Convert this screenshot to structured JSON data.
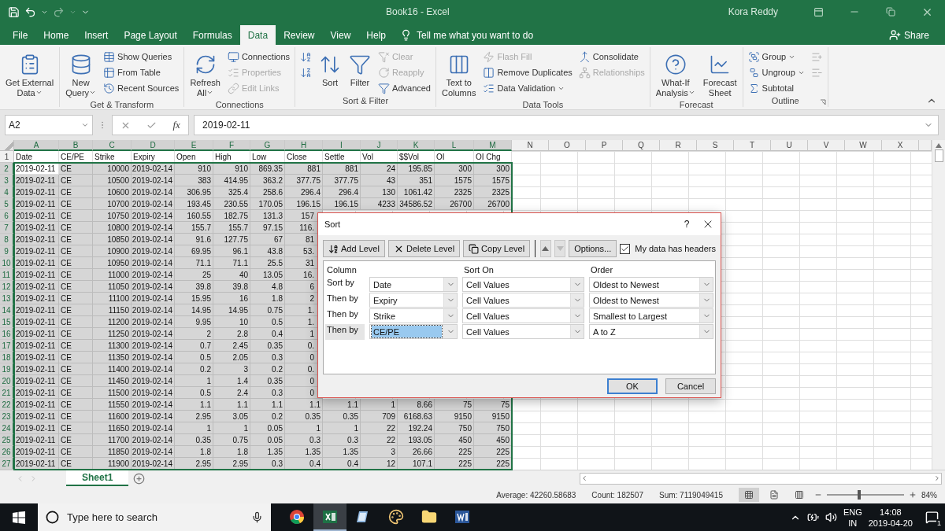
{
  "title_bar": {
    "title": "Book16 - Excel",
    "user": "Kora Reddy"
  },
  "menu_tabs": [
    {
      "label": "File",
      "selected": false
    },
    {
      "label": "Home",
      "selected": false
    },
    {
      "label": "Insert",
      "selected": false
    },
    {
      "label": "Page Layout",
      "selected": false
    },
    {
      "label": "Formulas",
      "selected": false
    },
    {
      "label": "Data",
      "selected": true
    },
    {
      "label": "Review",
      "selected": false
    },
    {
      "label": "View",
      "selected": false
    },
    {
      "label": "Help",
      "selected": false
    }
  ],
  "tell_me": "Tell me what you want to do",
  "share": "Share",
  "ribbon": {
    "groups": [
      {
        "items": [
          {
            "kind": "large",
            "lines": [
              "Get External",
              "Data"
            ],
            "dropdown": true,
            "disabled": false
          }
        ]
      },
      {
        "label": "Get & Transform",
        "items": [
          {
            "kind": "large",
            "lines": [
              "New",
              "Query"
            ],
            "dropdown": true,
            "disabled": false
          },
          {
            "kind": "stack",
            "items": [
              {
                "label": "Show Queries",
                "dropdown": false,
                "disabled": false
              },
              {
                "label": "From Table",
                "dropdown": false,
                "disabled": false
              },
              {
                "label": "Recent Sources",
                "dropdown": false,
                "disabled": false
              }
            ]
          }
        ]
      },
      {
        "label": "Connections",
        "items": [
          {
            "kind": "large",
            "lines": [
              "Refresh",
              "All"
            ],
            "dropdown": true,
            "disabled": false
          },
          {
            "kind": "stack",
            "items": [
              {
                "label": "Connections",
                "dropdown": false,
                "disabled": false
              },
              {
                "label": "Properties",
                "dropdown": false,
                "disabled": true
              },
              {
                "label": "Edit Links",
                "dropdown": false,
                "disabled": true
              }
            ]
          }
        ]
      },
      {
        "label": "Sort & Filter",
        "items": [
          {
            "kind": "stack",
            "items": [
              {
                "dropdown": false,
                "disabled": false
              },
              {
                "dropdown": false,
                "disabled": false
              }
            ]
          },
          {
            "kind": "large",
            "lines": [
              "Sort"
            ],
            "dropdown": false,
            "disabled": false
          },
          {
            "kind": "large",
            "lines": [
              "Filter"
            ],
            "dropdown": false,
            "disabled": false
          },
          {
            "kind": "stack",
            "items": [
              {
                "label": "Clear",
                "dropdown": false,
                "disabled": true
              },
              {
                "label": "Reapply",
                "dropdown": false,
                "disabled": true
              },
              {
                "label": "Advanced",
                "dropdown": false,
                "disabled": false
              }
            ]
          }
        ]
      },
      {
        "label": "Data Tools",
        "items": [
          {
            "kind": "large",
            "lines": [
              "Text to",
              "Columns"
            ],
            "dropdown": false,
            "disabled": false
          },
          {
            "kind": "stack",
            "items": [
              {
                "label": "Flash Fill",
                "dropdown": false,
                "disabled": true
              },
              {
                "label": "Remove Duplicates",
                "dropdown": false,
                "disabled": false
              },
              {
                "label": "Data Validation",
                "dropdown": true,
                "disabled": false
              }
            ]
          },
          {
            "kind": "stack",
            "items": [
              {
                "label": "Consolidate",
                "dropdown": false,
                "disabled": false
              },
              {
                "label": "Relationships",
                "dropdown": false,
                "disabled": true
              }
            ]
          }
        ]
      },
      {
        "label": "Forecast",
        "items": [
          {
            "kind": "large",
            "lines": [
              "What-If",
              "Analysis"
            ],
            "dropdown": true,
            "disabled": false
          },
          {
            "kind": "large",
            "lines": [
              "Forecast",
              "Sheet"
            ],
            "dropdown": false,
            "disabled": false
          }
        ]
      },
      {
        "label": "Outline",
        "launcher": true,
        "items": [
          {
            "kind": "stack",
            "items": [
              {
                "label": "Group",
                "dropdown": true,
                "disabled": false
              },
              {
                "label": "Ungroup",
                "dropdown": true,
                "disabled": false
              },
              {
                "label": "Subtotal",
                "dropdown": false,
                "disabled": false
              }
            ]
          },
          {
            "kind": "stack",
            "items": [
              {
                "dropdown": false,
                "disabled": true
              },
              {
                "dropdown": false,
                "disabled": true
              }
            ]
          }
        ]
      }
    ]
  },
  "formula_bar": {
    "name_box": "A2",
    "fx": "fx",
    "value": "2019-02-11"
  },
  "columns": [
    {
      "letter": "A",
      "selected": true
    },
    {
      "letter": "B",
      "selected": true
    },
    {
      "letter": "C",
      "selected": true
    },
    {
      "letter": "D",
      "selected": true
    },
    {
      "letter": "E",
      "selected": true
    },
    {
      "letter": "F",
      "selected": true
    },
    {
      "letter": "G",
      "selected": true
    },
    {
      "letter": "H",
      "selected": true
    },
    {
      "letter": "I",
      "selected": true
    },
    {
      "letter": "J",
      "selected": true
    },
    {
      "letter": "K",
      "selected": true
    },
    {
      "letter": "L",
      "selected": true
    },
    {
      "letter": "M",
      "selected": true
    },
    {
      "letter": "N",
      "selected": false
    },
    {
      "letter": "O",
      "selected": false
    },
    {
      "letter": "P",
      "selected": false
    },
    {
      "letter": "Q",
      "selected": false
    },
    {
      "letter": "R",
      "selected": false
    },
    {
      "letter": "S",
      "selected": false
    },
    {
      "letter": "T",
      "selected": false
    },
    {
      "letter": "U",
      "selected": false
    },
    {
      "letter": "V",
      "selected": false
    },
    {
      "letter": "W",
      "selected": false
    },
    {
      "letter": "X",
      "selected": false
    }
  ],
  "rows": [
    {
      "number": "1",
      "selected": false,
      "cells": [
        "Date",
        "CE/PE",
        "Strike",
        "Expiry",
        "Open",
        "High",
        "Low",
        "Close",
        "Settle",
        "Vol",
        "$$Vol",
        "OI",
        "OI Chg"
      ]
    },
    {
      "number": "2",
      "selected": true,
      "cells": [
        "2019-02-11",
        "CE",
        "10000",
        "2019-02-14",
        "910",
        "910",
        "869.35",
        "881",
        "881",
        "24",
        "195.85",
        "300",
        "300"
      ]
    },
    {
      "number": "3",
      "selected": true,
      "cells": [
        "2019-02-11",
        "CE",
        "10500",
        "2019-02-14",
        "383",
        "414.95",
        "363.2",
        "377.75",
        "377.75",
        "43",
        "351",
        "1575",
        "1575"
      ]
    },
    {
      "number": "4",
      "selected": true,
      "cells": [
        "2019-02-11",
        "CE",
        "10600",
        "2019-02-14",
        "306.95",
        "325.4",
        "258.6",
        "296.4",
        "296.4",
        "130",
        "1061.42",
        "2325",
        "2325"
      ]
    },
    {
      "number": "5",
      "selected": true,
      "cells": [
        "2019-02-11",
        "CE",
        "10700",
        "2019-02-14",
        "193.45",
        "230.55",
        "170.05",
        "196.15",
        "196.15",
        "4233",
        "34586.52",
        "26700",
        "26700"
      ]
    },
    {
      "number": "6",
      "selected": true,
      "cells": [
        "2019-02-11",
        "CE",
        "10750",
        "2019-02-14",
        "160.55",
        "182.75",
        "131.3",
        "157"
      ]
    },
    {
      "number": "7",
      "selected": true,
      "cells": [
        "2019-02-11",
        "CE",
        "10800",
        "2019-02-14",
        "155.7",
        "155.7",
        "97.15",
        "116."
      ]
    },
    {
      "number": "8",
      "selected": true,
      "cells": [
        "2019-02-11",
        "CE",
        "10850",
        "2019-02-14",
        "91.6",
        "127.75",
        "67",
        "81"
      ]
    },
    {
      "number": "9",
      "selected": true,
      "cells": [
        "2019-02-11",
        "CE",
        "10900",
        "2019-02-14",
        "69.95",
        "96.1",
        "43.8",
        "53."
      ]
    },
    {
      "number": "10",
      "selected": true,
      "cells": [
        "2019-02-11",
        "CE",
        "10950",
        "2019-02-14",
        "71.1",
        "71.1",
        "25.5",
        "31"
      ]
    },
    {
      "number": "11",
      "selected": true,
      "cells": [
        "2019-02-11",
        "CE",
        "11000",
        "2019-02-14",
        "25",
        "40",
        "13.05",
        "16."
      ]
    },
    {
      "number": "12",
      "selected": true,
      "cells": [
        "2019-02-11",
        "CE",
        "11050",
        "2019-02-14",
        "39.8",
        "39.8",
        "4.8",
        "6"
      ]
    },
    {
      "number": "13",
      "selected": true,
      "cells": [
        "2019-02-11",
        "CE",
        "11100",
        "2019-02-14",
        "15.95",
        "16",
        "1.8",
        "2"
      ]
    },
    {
      "number": "14",
      "selected": true,
      "cells": [
        "2019-02-11",
        "CE",
        "11150",
        "2019-02-14",
        "14.95",
        "14.95",
        "0.75",
        "1."
      ]
    },
    {
      "number": "15",
      "selected": true,
      "cells": [
        "2019-02-11",
        "CE",
        "11200",
        "2019-02-14",
        "9.95",
        "10",
        "0.5",
        "1."
      ]
    },
    {
      "number": "16",
      "selected": true,
      "cells": [
        "2019-02-11",
        "CE",
        "11250",
        "2019-02-14",
        "2",
        "2.8",
        "0.4",
        "1"
      ]
    },
    {
      "number": "17",
      "selected": true,
      "cells": [
        "2019-02-11",
        "CE",
        "11300",
        "2019-02-14",
        "0.7",
        "2.45",
        "0.35",
        "0."
      ]
    },
    {
      "number": "18",
      "selected": true,
      "cells": [
        "2019-02-11",
        "CE",
        "11350",
        "2019-02-14",
        "0.5",
        "2.05",
        "0.3",
        "0"
      ]
    },
    {
      "number": "19",
      "selected": true,
      "cells": [
        "2019-02-11",
        "CE",
        "11400",
        "2019-02-14",
        "0.2",
        "3",
        "0.2",
        "0."
      ]
    },
    {
      "number": "20",
      "selected": true,
      "cells": [
        "2019-02-11",
        "CE",
        "11450",
        "2019-02-14",
        "1",
        "1.4",
        "0.35",
        "0"
      ]
    },
    {
      "number": "21",
      "selected": true,
      "cells": [
        "2019-02-11",
        "CE",
        "11500",
        "2019-02-14",
        "0.5",
        "2.4",
        "0.3",
        "0"
      ]
    },
    {
      "number": "22",
      "selected": true,
      "cells": [
        "2019-02-11",
        "CE",
        "11550",
        "2019-02-14",
        "1.1",
        "1.1",
        "1.1",
        "1.1",
        "1.1",
        "1",
        "8.66",
        "75",
        "75"
      ]
    },
    {
      "number": "23",
      "selected": true,
      "cells": [
        "2019-02-11",
        "CE",
        "11600",
        "2019-02-14",
        "2.95",
        "3.05",
        "0.2",
        "0.35",
        "0.35",
        "709",
        "6168.63",
        "9150",
        "9150"
      ]
    },
    {
      "number": "24",
      "selected": true,
      "cells": [
        "2019-02-11",
        "CE",
        "11650",
        "2019-02-14",
        "1",
        "1",
        "0.05",
        "1",
        "1",
        "22",
        "192.24",
        "750",
        "750"
      ]
    },
    {
      "number": "25",
      "selected": true,
      "cells": [
        "2019-02-11",
        "CE",
        "11700",
        "2019-02-14",
        "0.35",
        "0.75",
        "0.05",
        "0.3",
        "0.3",
        "22",
        "193.05",
        "450",
        "450"
      ]
    },
    {
      "number": "26",
      "selected": true,
      "cells": [
        "2019-02-11",
        "CE",
        "11850",
        "2019-02-14",
        "1.8",
        "1.8",
        "1.35",
        "1.35",
        "1.35",
        "3",
        "26.66",
        "225",
        "225"
      ]
    },
    {
      "number": "27",
      "selected": true,
      "cells": [
        "2019-02-11",
        "CE",
        "11900",
        "2019-02-14",
        "2.95",
        "2.95",
        "0.3",
        "0.4",
        "0.4",
        "12",
        "107.1",
        "225",
        "225"
      ]
    }
  ],
  "sort_dialog": {
    "title": "Sort",
    "help": "?",
    "toolbar": [
      {
        "label": "Add Level"
      },
      {
        "label": "Delete Level"
      },
      {
        "label": "Copy Level"
      }
    ],
    "options": "Options...",
    "headers_checkbox": {
      "label": "My data has headers",
      "checked": true
    },
    "headings": [
      "Column",
      "Sort On",
      "Order"
    ],
    "levels": [
      {
        "label": "Sort by",
        "column": "Date",
        "sort_on": "Cell Values",
        "order": "Oldest to Newest",
        "selected": false
      },
      {
        "label": "Then by",
        "column": "Expiry",
        "sort_on": "Cell Values",
        "order": "Oldest to Newest",
        "selected": false
      },
      {
        "label": "Then by",
        "column": "Strike",
        "sort_on": "Cell Values",
        "order": "Smallest to Largest",
        "selected": false
      },
      {
        "label": "Then by",
        "column": "CE/PE",
        "sort_on": "Cell Values",
        "order": "A to Z",
        "selected": true
      }
    ],
    "buttons": [
      "OK",
      "Cancel"
    ]
  },
  "sheet_tabs": [
    {
      "label": "Sheet1",
      "selected": true
    }
  ],
  "status_bar": {
    "average": "Average: 42260.58683",
    "count": "Count: 182507",
    "sum": "Sum: 7119049415",
    "views": [
      {
        "selected": true
      },
      {
        "selected": false
      },
      {
        "selected": false
      }
    ],
    "zoom": {
      "level": 0.42,
      "reading": "84%"
    }
  },
  "taskbar": {
    "search_placeholder": "Type here to search",
    "apps": [
      {
        "selected": false
      },
      {
        "selected": true
      },
      {
        "selected": false
      },
      {
        "selected": false
      },
      {
        "selected": false
      },
      {
        "selected": false
      }
    ],
    "language": "ENG",
    "region": "IN",
    "time": "14:08",
    "date": "2019-04-20",
    "notifications": "1"
  }
}
